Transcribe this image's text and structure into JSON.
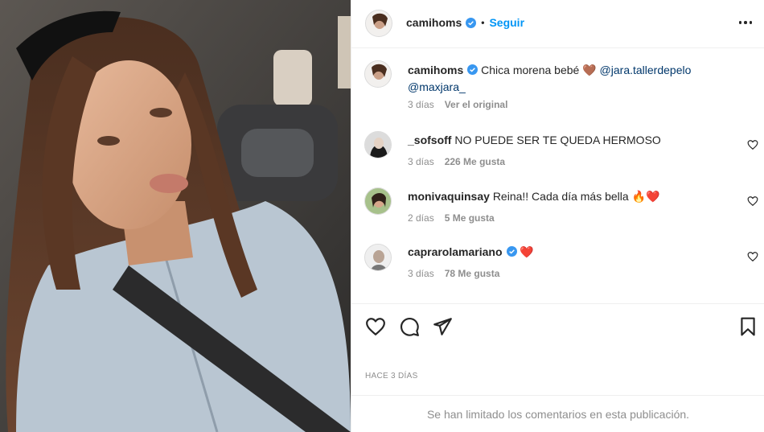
{
  "post": {
    "username": "camihoms",
    "follow_label": "Seguir",
    "separator": "•"
  },
  "caption": {
    "username": "camihoms",
    "text": "Chica morena bebé 🤎",
    "mention1": "@jara.tallerdepelo",
    "mention2": "@maxjara_",
    "time": "3 días",
    "see_original": "Ver el original"
  },
  "comments": [
    {
      "username": "_sofsoff",
      "text": "NO PUEDE SER TE QUEDA HERMOSO",
      "time": "3 días",
      "likes": "226 Me gusta"
    },
    {
      "username": "monivaquinsay",
      "text": "Reina!! Cada día más bella 🔥❤️",
      "time": "2 días",
      "likes": "5 Me gusta"
    },
    {
      "username": "caprarolamariano",
      "text": "❤️",
      "time": "3 días",
      "likes": "78 Me gusta"
    }
  ],
  "post_date": "HACE 3 DÍAS",
  "footer_text": "Se han limitado los comentarios en esta publicación.",
  "colors": {
    "accent": "#0095f6",
    "mention": "#00376b",
    "muted": "#8e8e8e",
    "verified": "#3897f0"
  },
  "icons": [
    "heart-icon",
    "comment-icon",
    "share-icon",
    "bookmark-icon",
    "verified-icon",
    "more-icon"
  ]
}
